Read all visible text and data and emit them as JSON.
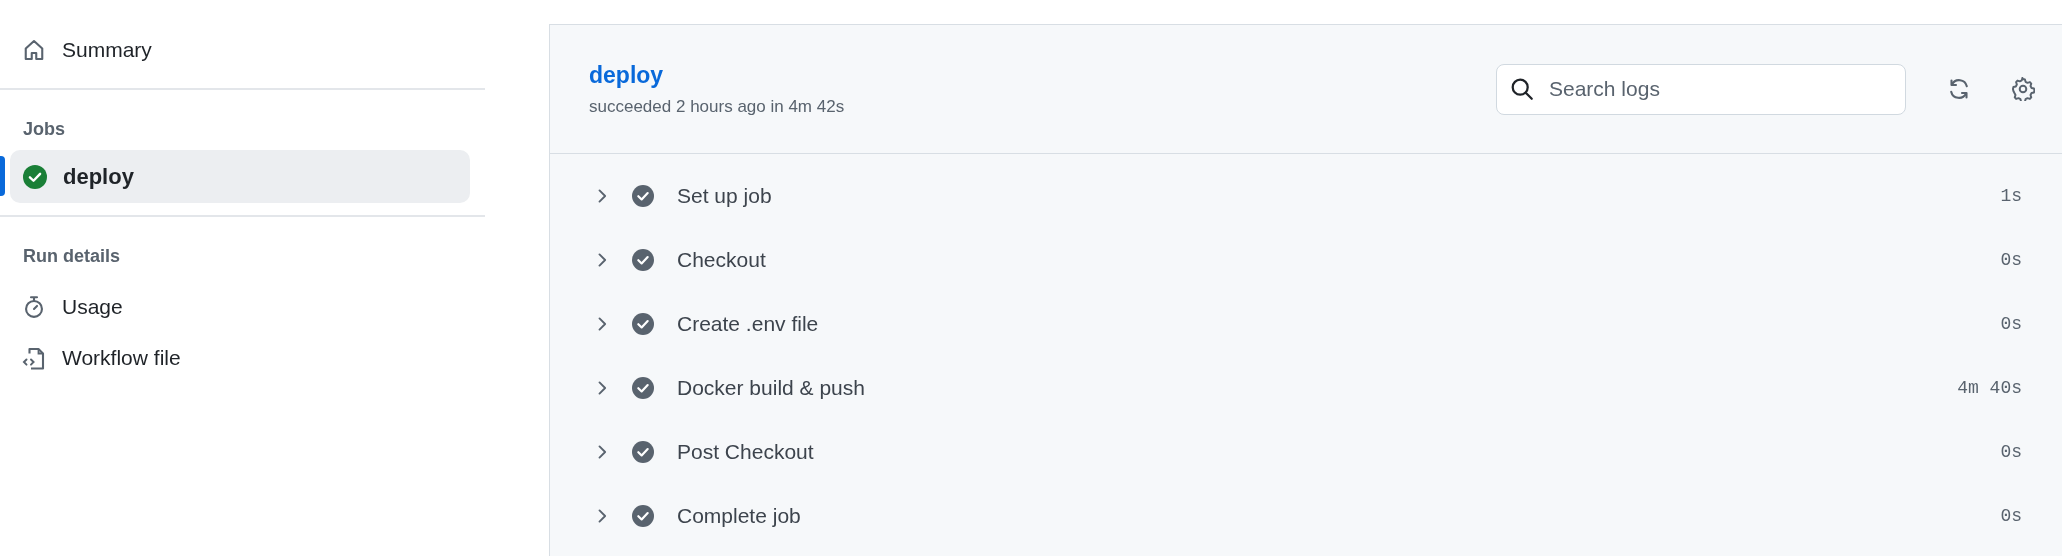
{
  "sidebar": {
    "summary": {
      "label": "Summary"
    },
    "jobs_heading": "Jobs",
    "jobs": [
      {
        "label": "deploy",
        "kind": "success",
        "selected": true
      }
    ],
    "run_details_heading": "Run details",
    "run_details": [
      {
        "label": "Usage",
        "kind": "usage"
      },
      {
        "label": "Workflow file",
        "kind": "workflow"
      }
    ]
  },
  "job": {
    "title": "deploy",
    "subtitle": "succeeded 2 hours ago in 4m 42s",
    "search": {
      "placeholder": "Search logs"
    },
    "steps": [
      {
        "name": "Set up job",
        "kind": "success",
        "duration": "1s",
        "expanded": false
      },
      {
        "name": "Checkout",
        "kind": "success",
        "duration": "0s",
        "expanded": false
      },
      {
        "name": "Create .env file",
        "kind": "success",
        "duration": "0s",
        "expanded": false
      },
      {
        "name": "Docker build & push",
        "kind": "success",
        "duration": "4m 40s",
        "expanded": false
      },
      {
        "name": "Post Checkout",
        "kind": "success",
        "duration": "0s",
        "expanded": false
      },
      {
        "name": "Complete job",
        "kind": "success",
        "duration": "0s",
        "expanded": false
      }
    ]
  }
}
